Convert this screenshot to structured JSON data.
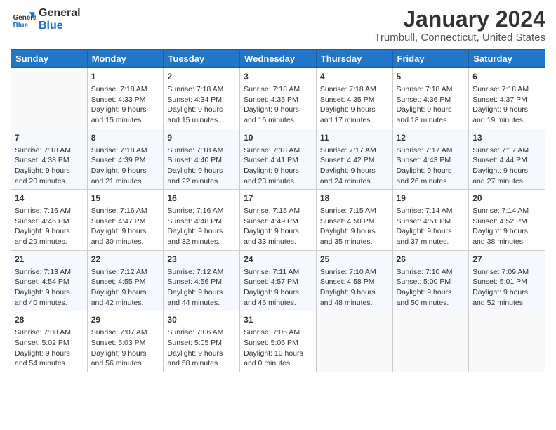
{
  "header": {
    "logo_general": "General",
    "logo_blue": "Blue",
    "title": "January 2024",
    "subtitle": "Trumbull, Connecticut, United States"
  },
  "weekdays": [
    "Sunday",
    "Monday",
    "Tuesday",
    "Wednesday",
    "Thursday",
    "Friday",
    "Saturday"
  ],
  "weeks": [
    [
      {
        "day": "",
        "content": ""
      },
      {
        "day": "1",
        "content": "Sunrise: 7:18 AM\nSunset: 4:33 PM\nDaylight: 9 hours\nand 15 minutes."
      },
      {
        "day": "2",
        "content": "Sunrise: 7:18 AM\nSunset: 4:34 PM\nDaylight: 9 hours\nand 15 minutes."
      },
      {
        "day": "3",
        "content": "Sunrise: 7:18 AM\nSunset: 4:35 PM\nDaylight: 9 hours\nand 16 minutes."
      },
      {
        "day": "4",
        "content": "Sunrise: 7:18 AM\nSunset: 4:35 PM\nDaylight: 9 hours\nand 17 minutes."
      },
      {
        "day": "5",
        "content": "Sunrise: 7:18 AM\nSunset: 4:36 PM\nDaylight: 9 hours\nand 18 minutes."
      },
      {
        "day": "6",
        "content": "Sunrise: 7:18 AM\nSunset: 4:37 PM\nDaylight: 9 hours\nand 19 minutes."
      }
    ],
    [
      {
        "day": "7",
        "content": "Sunrise: 7:18 AM\nSunset: 4:38 PM\nDaylight: 9 hours\nand 20 minutes."
      },
      {
        "day": "8",
        "content": "Sunrise: 7:18 AM\nSunset: 4:39 PM\nDaylight: 9 hours\nand 21 minutes."
      },
      {
        "day": "9",
        "content": "Sunrise: 7:18 AM\nSunset: 4:40 PM\nDaylight: 9 hours\nand 22 minutes."
      },
      {
        "day": "10",
        "content": "Sunrise: 7:18 AM\nSunset: 4:41 PM\nDaylight: 9 hours\nand 23 minutes."
      },
      {
        "day": "11",
        "content": "Sunrise: 7:17 AM\nSunset: 4:42 PM\nDaylight: 9 hours\nand 24 minutes."
      },
      {
        "day": "12",
        "content": "Sunrise: 7:17 AM\nSunset: 4:43 PM\nDaylight: 9 hours\nand 26 minutes."
      },
      {
        "day": "13",
        "content": "Sunrise: 7:17 AM\nSunset: 4:44 PM\nDaylight: 9 hours\nand 27 minutes."
      }
    ],
    [
      {
        "day": "14",
        "content": "Sunrise: 7:16 AM\nSunset: 4:46 PM\nDaylight: 9 hours\nand 29 minutes."
      },
      {
        "day": "15",
        "content": "Sunrise: 7:16 AM\nSunset: 4:47 PM\nDaylight: 9 hours\nand 30 minutes."
      },
      {
        "day": "16",
        "content": "Sunrise: 7:16 AM\nSunset: 4:48 PM\nDaylight: 9 hours\nand 32 minutes."
      },
      {
        "day": "17",
        "content": "Sunrise: 7:15 AM\nSunset: 4:49 PM\nDaylight: 9 hours\nand 33 minutes."
      },
      {
        "day": "18",
        "content": "Sunrise: 7:15 AM\nSunset: 4:50 PM\nDaylight: 9 hours\nand 35 minutes."
      },
      {
        "day": "19",
        "content": "Sunrise: 7:14 AM\nSunset: 4:51 PM\nDaylight: 9 hours\nand 37 minutes."
      },
      {
        "day": "20",
        "content": "Sunrise: 7:14 AM\nSunset: 4:52 PM\nDaylight: 9 hours\nand 38 minutes."
      }
    ],
    [
      {
        "day": "21",
        "content": "Sunrise: 7:13 AM\nSunset: 4:54 PM\nDaylight: 9 hours\nand 40 minutes."
      },
      {
        "day": "22",
        "content": "Sunrise: 7:12 AM\nSunset: 4:55 PM\nDaylight: 9 hours\nand 42 minutes."
      },
      {
        "day": "23",
        "content": "Sunrise: 7:12 AM\nSunset: 4:56 PM\nDaylight: 9 hours\nand 44 minutes."
      },
      {
        "day": "24",
        "content": "Sunrise: 7:11 AM\nSunset: 4:57 PM\nDaylight: 9 hours\nand 46 minutes."
      },
      {
        "day": "25",
        "content": "Sunrise: 7:10 AM\nSunset: 4:58 PM\nDaylight: 9 hours\nand 48 minutes."
      },
      {
        "day": "26",
        "content": "Sunrise: 7:10 AM\nSunset: 5:00 PM\nDaylight: 9 hours\nand 50 minutes."
      },
      {
        "day": "27",
        "content": "Sunrise: 7:09 AM\nSunset: 5:01 PM\nDaylight: 9 hours\nand 52 minutes."
      }
    ],
    [
      {
        "day": "28",
        "content": "Sunrise: 7:08 AM\nSunset: 5:02 PM\nDaylight: 9 hours\nand 54 minutes."
      },
      {
        "day": "29",
        "content": "Sunrise: 7:07 AM\nSunset: 5:03 PM\nDaylight: 9 hours\nand 56 minutes."
      },
      {
        "day": "30",
        "content": "Sunrise: 7:06 AM\nSunset: 5:05 PM\nDaylight: 9 hours\nand 58 minutes."
      },
      {
        "day": "31",
        "content": "Sunrise: 7:05 AM\nSunset: 5:06 PM\nDaylight: 10 hours\nand 0 minutes."
      },
      {
        "day": "",
        "content": ""
      },
      {
        "day": "",
        "content": ""
      },
      {
        "day": "",
        "content": ""
      }
    ]
  ]
}
